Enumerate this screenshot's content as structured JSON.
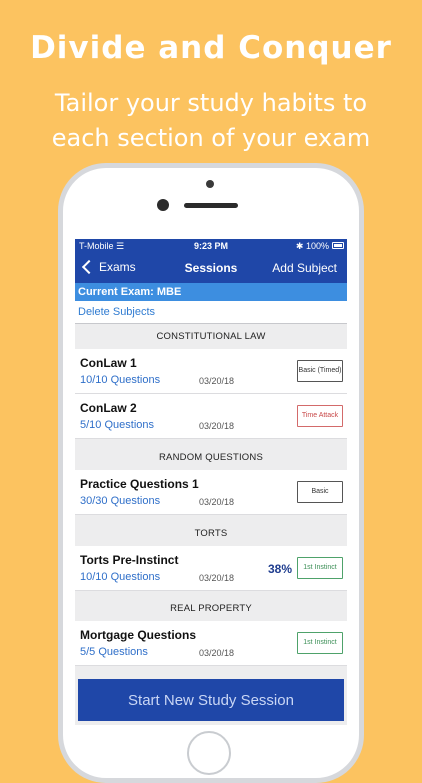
{
  "promo": {
    "headline": "Divide and Conquer",
    "sub_line1": "Tailor your study habits to",
    "sub_line2": "each section of your exam"
  },
  "status_bar": {
    "carrier": "T-Mobile",
    "time": "9:23 PM",
    "battery": "100%"
  },
  "nav": {
    "back_label": "Exams",
    "title": "Sessions",
    "action_label": "Add Subject"
  },
  "current_exam": "Current Exam: MBE",
  "delete_subjects": "Delete Subjects",
  "sections": [
    {
      "header": "CONSTITUTIONAL LAW",
      "rows": [
        {
          "title": "ConLaw 1",
          "questions": "10/10 Questions",
          "date": "03/20/18",
          "badge": "Basic (Timed)"
        },
        {
          "title": "ConLaw 2",
          "questions": "5/10 Questions",
          "date": "03/20/18",
          "badge": "Time Attack"
        }
      ]
    },
    {
      "header": "RANDOM QUESTIONS",
      "rows": [
        {
          "title": "Practice Questions 1",
          "questions": "30/30 Questions",
          "date": "03/20/18",
          "badge": "Basic"
        }
      ]
    },
    {
      "header": "TORTS",
      "rows": [
        {
          "title": "Torts Pre-Instinct",
          "questions": "10/10 Questions",
          "date": "03/20/18",
          "percent": "38%",
          "badge": "1st Instinct"
        }
      ]
    },
    {
      "header": "REAL PROPERTY",
      "rows": [
        {
          "title": "Mortgage Questions",
          "questions": "5/5 Questions",
          "date": "03/20/18",
          "badge": "1st Instinct"
        }
      ]
    }
  ],
  "start_button": "Start New Study Session",
  "colors": {
    "background": "#fcc360",
    "nav_blue": "#1f47a8",
    "exam_bar": "#3d8ee0",
    "link_blue": "#2f7bd1"
  }
}
